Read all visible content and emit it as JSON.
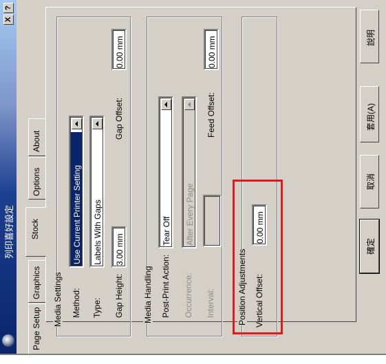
{
  "window": {
    "title": "列印喜好設定",
    "help_label": "?",
    "close_label": "X"
  },
  "tabs": [
    {
      "label": "Page Setup"
    },
    {
      "label": "Graphics"
    },
    {
      "label": "Stock"
    },
    {
      "label": "Options"
    },
    {
      "label": "About"
    }
  ],
  "media_settings": {
    "group_title": "Media Settings",
    "method_label": "Method:",
    "method_value": "Use Current Printer Setting",
    "type_label": "Type:",
    "type_value": "Labels With Gaps",
    "gap_height_label": "Gap Height:",
    "gap_height_value": "3.00 mm",
    "gap_offset_label": "Gap Offset:",
    "gap_offset_value": "0.00 mm"
  },
  "media_handling": {
    "group_title": "Media Handling",
    "post_print_label": "Post-Print Action:",
    "post_print_value": "Tear Off",
    "occurrence_label": "Occurrence:",
    "occurrence_value": "After Every Page",
    "interval_label": "Interval:",
    "interval_value": "",
    "feed_offset_label": "Feed Offset:",
    "feed_offset_value": "0.00 mm"
  },
  "position_adjustments": {
    "group_title": "Position Adjustments",
    "vertical_offset_label": "Vertical Offset:",
    "vertical_offset_value": "0.00 mm"
  },
  "buttons": {
    "ok": "確定",
    "cancel": "取消",
    "apply": "套用(A)",
    "help": "說明"
  },
  "colors": {
    "highlight": "#e0191a",
    "titlebar": "#0a246a",
    "face": "#d4d0c8"
  }
}
